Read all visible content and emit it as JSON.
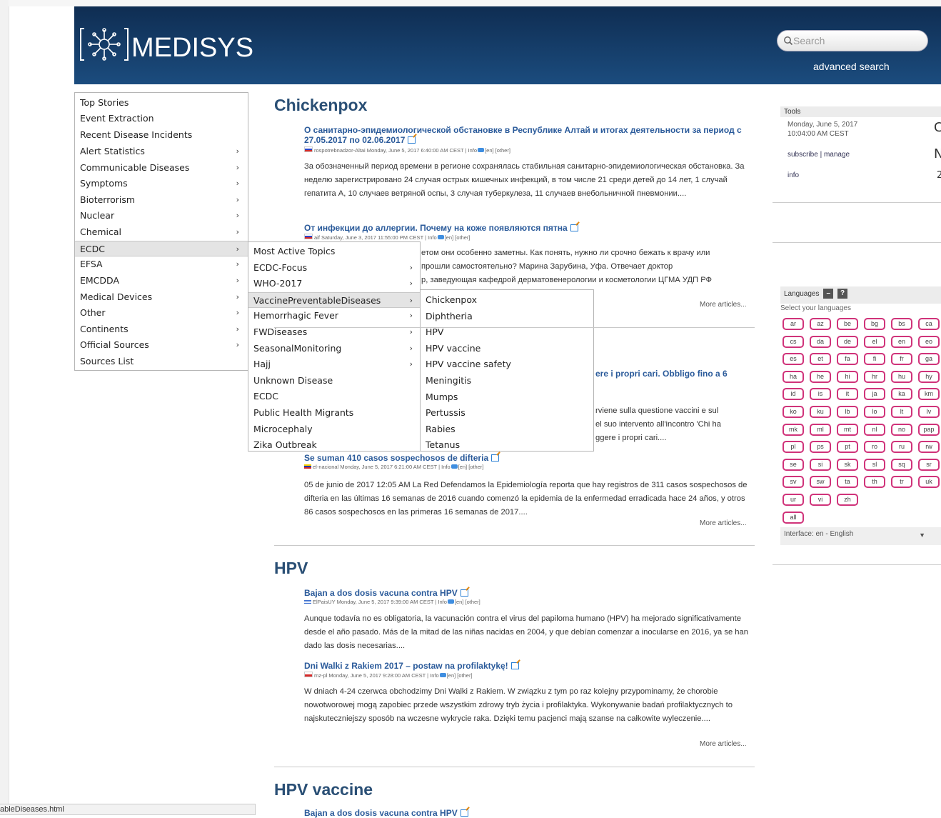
{
  "header": {
    "logo_text": "MEDISYS",
    "search_placeholder": "Search",
    "advanced_search": "advanced search"
  },
  "menu": {
    "items": [
      {
        "label": "Top Stories",
        "arrow": false
      },
      {
        "label": "Event Extraction",
        "arrow": false
      },
      {
        "label": "Recent Disease Incidents",
        "arrow": false
      },
      {
        "label": "Alert Statistics",
        "arrow": true
      },
      {
        "label": "Communicable Diseases",
        "arrow": true
      },
      {
        "label": "Symptoms",
        "arrow": true
      },
      {
        "label": "Bioterrorism",
        "arrow": true
      },
      {
        "label": "Nuclear",
        "arrow": true
      },
      {
        "label": "Chemical",
        "arrow": true
      },
      {
        "label": "ECDC",
        "arrow": true
      },
      {
        "label": "EFSA",
        "arrow": true
      },
      {
        "label": "EMCDDA",
        "arrow": true
      },
      {
        "label": "Medical Devices",
        "arrow": true
      },
      {
        "label": "Other",
        "arrow": true
      },
      {
        "label": "Continents",
        "arrow": true
      },
      {
        "label": "Official Sources",
        "arrow": true
      },
      {
        "label": "Sources List",
        "arrow": false
      }
    ],
    "submenu": [
      {
        "label": "Most Active Topics",
        "arrow": false
      },
      {
        "label": "ECDC-Focus",
        "arrow": true
      },
      {
        "label": "WHO-2017",
        "arrow": true
      },
      {
        "label": "VaccinePreventableDiseases",
        "arrow": true
      },
      {
        "label": "Hemorrhagic Fever",
        "arrow": true
      },
      {
        "label": "FWDiseases",
        "arrow": true
      },
      {
        "label": "SeasonalMonitoring",
        "arrow": true
      },
      {
        "label": "Hajj",
        "arrow": true
      },
      {
        "label": "Unknown Disease",
        "arrow": false
      },
      {
        "label": "ECDC",
        "arrow": false
      },
      {
        "label": "Public Health Migrants",
        "arrow": false
      },
      {
        "label": "Microcephaly",
        "arrow": false
      },
      {
        "label": "Zika Outbreak",
        "arrow": false
      }
    ],
    "submenu2": [
      "Chickenpox",
      "Diphtheria",
      "HPV",
      "HPV vaccine",
      "HPV vaccine safety",
      "Meningitis",
      "Mumps",
      "Pertussis",
      "Rabies",
      "Tetanus"
    ]
  },
  "sections": {
    "chickenpox": {
      "title": "Chickenpox",
      "a1_title": "О санитарно-эпидемиологической обстановке в Республике Алтай и итогах деятельности за период с 27.05.2017 по 02.06.2017",
      "a1_meta": "rospotrebnadzor-Altai Monday, June 5, 2017 6:40:00 AM CEST | Info",
      "a1_meta_tail": "[en] [other]",
      "a1_body": "За обозначенный период времени в регионе сохранялась стабильная санитарно-эпидемиологическая обстановка. За неделю зарегистрировано 24 случая острых кишечных инфекций, в том числе 21 среди детей до 14 лет, 1 случай гепатита А, 10 случаев ветряной оспы, 3 случая туберкулеза, 11 случаев внебольничной пневмонии....",
      "a2_title": "От инфекции до аллергии. Почему на коже появляются пятна",
      "a2_meta": "aif Saturday, June 3, 2017 11:55:00 PM CEST | Info",
      "a2_meta_tail": "[en] [other]",
      "a2_body_1": "етом они особенно заметны. Как понять, нужно ли срочно бежать к врачу или",
      "a2_body_2": "прошли самостоятельно? Марина Зарубина, Уфа. Отвечает доктор",
      "a2_body_3": "р, заведующая кафедрой дерматовенерологии и косметологии ЦГМА УДП РФ",
      "more": "More articles..."
    },
    "diphtheria": {
      "partial_title": "ere i propri cari. Obbligo fino a 6",
      "partial_body_1": "rviene sulla questione vaccini e sul",
      "partial_body_2": "el suo intervento all'incontro 'Chi ha",
      "partial_body_3": "ggere i propri cari....",
      "a3_title": "Se suman 410 casos sospechosos de difteria",
      "a3_meta": "el-nacional Monday, June 5, 2017 6:21:00 AM CEST | Info",
      "a3_meta_tail": "[en] [other]",
      "a3_body": "05 de junio de 2017 12:05 AM La Red Defendamos la Epidemiología reporta que hay registros de 311 casos sospechosos de difteria en las últimas 16 semanas de 2016 cuando comenzó la epidemia de la enfermedad erradicada hace 24 años, y otros 86 casos sospechosos en las primeras 16 semanas de 2017....",
      "more": "More articles..."
    },
    "hpv": {
      "title": "HPV",
      "a1_title": "Bajan a dos dosis vacuna contra HPV",
      "a1_meta": "ElPaisUY Monday, June 5, 2017 9:39:00 AM CEST | Info",
      "a1_meta_tail": "[en] [other]",
      "a1_body": "Aunque todavía no es obligatoria, la vacunación contra el virus del papiloma humano (HPV) ha mejorado significativamente desde el año pasado. Más de la mitad de las niñas nacidas en 2004, y que debían comenzar a inocularse en 2016, ya se han dado las dosis necesarias....",
      "a2_title": "Dni Walki z Rakiem 2017 – postaw na profilaktykę!",
      "a2_meta": "mz-pl Monday, June 5, 2017 9:28:00 AM CEST | Info",
      "a2_meta_tail": "[en] [other]",
      "a2_body": "W dniach 4-24 czerwca obchodzimy Dni Walki z Rakiem. W związku z tym po raz kolejny przypominamy, że chorobie nowotworowej mogą zapobiec przede wszystkim zdrowy tryb życia i profilaktyka. Wykonywanie badań profilaktycznych to najskuteczniejszy sposób na wczesne wykrycie raka. Dzięki temu pacjenci mają szanse na całkowite wyleczenie....",
      "more": "More articles..."
    },
    "hpv_vaccine": {
      "title": "HPV vaccine",
      "a1_title": "Bajan a dos dosis vacuna contra HPV"
    }
  },
  "tools": {
    "heading": "Tools",
    "date_line1": "Monday, June 5, 2017",
    "date_line2": "10:04:00 AM CEST",
    "subscribe": "subscribe | manage",
    "info": "info",
    "glyph1": "C",
    "glyph2": "N",
    "glyph3": "2"
  },
  "languages": {
    "heading": "Languages",
    "minus": "–",
    "help": "?",
    "subheading": "Select your languages",
    "codes": [
      "ar",
      "az",
      "be",
      "bg",
      "bs",
      "ca",
      "cs",
      "da",
      "de",
      "el",
      "en",
      "eo",
      "es",
      "et",
      "fa",
      "fi",
      "fr",
      "ga",
      "ha",
      "he",
      "hi",
      "hr",
      "hu",
      "hy",
      "id",
      "is",
      "it",
      "ja",
      "ka",
      "km",
      "ko",
      "ku",
      "lb",
      "lo",
      "lt",
      "lv",
      "mk",
      "ml",
      "mt",
      "nl",
      "no",
      "pap",
      "pl",
      "ps",
      "pt",
      "ro",
      "ru",
      "rw",
      "se",
      "si",
      "sk",
      "sl",
      "sq",
      "sr",
      "sv",
      "sw",
      "ta",
      "th",
      "tr",
      "uk",
      "ur",
      "vi",
      "zh"
    ],
    "all": "all",
    "interface": "Interface: en - English",
    "interface_arrow": "▼"
  },
  "status_bar": {
    "url": "ableDiseases.html"
  }
}
